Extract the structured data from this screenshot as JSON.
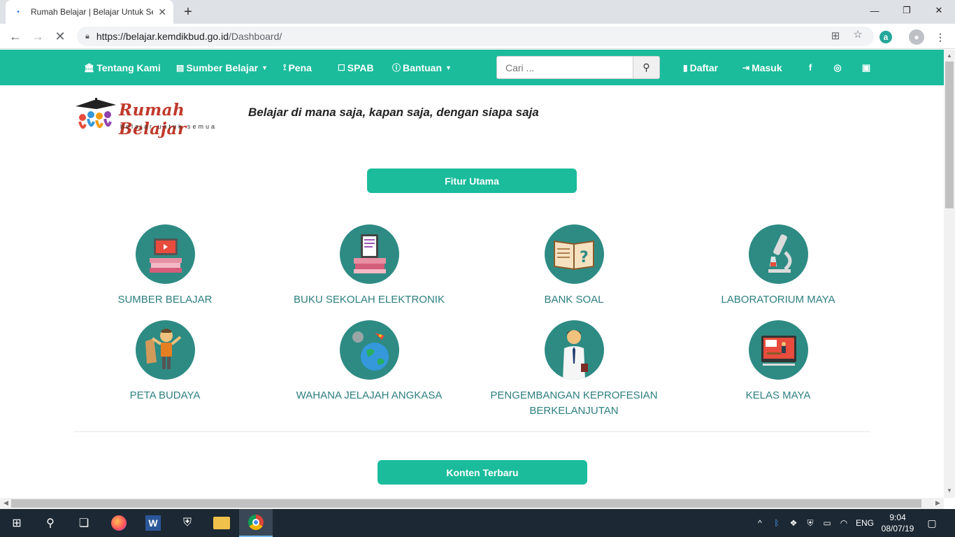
{
  "browser": {
    "tab_title": "Rumah Belajar | Belajar Untuk Semua",
    "new_tab": "+",
    "url_host": "https://belajar.kemdikbud.go.id",
    "url_path": "/Dashboard/",
    "minimize": "—",
    "restore": "❐",
    "close": "✕",
    "ext_label": "a"
  },
  "nav": {
    "tentang": "Tentang Kami",
    "sumber": "Sumber Belajar",
    "pena": "Pena",
    "spab": "SPAB",
    "bantuan": "Bantuan",
    "search_placeholder": "Cari ...",
    "daftar": "Daftar",
    "masuk": "Masuk",
    "facebook": "f"
  },
  "header": {
    "brand": "Rumah Belajar",
    "brand_sub": "belajar untuk semua",
    "tagline": "Belajar di mana saja, kapan saja, dengan siapa saja"
  },
  "sections": {
    "fitur_utama": "Fitur Utama",
    "konten_terbaru": "Konten Terbaru"
  },
  "features": [
    {
      "label": "SUMBER BELAJAR",
      "icon": "laptop-books-icon"
    },
    {
      "label": "BUKU SEKOLAH ELEKTRONIK",
      "icon": "ebook-icon"
    },
    {
      "label": "BANK SOAL",
      "icon": "question-book-icon"
    },
    {
      "label": "LABORATORIUM MAYA",
      "icon": "microscope-icon"
    },
    {
      "label": "PETA BUDAYA",
      "icon": "culture-map-icon"
    },
    {
      "label": "WAHANA JELAJAH ANGKASA",
      "icon": "globe-space-icon"
    },
    {
      "label": "PENGEMBANGAN KEPROFESIAN BERKELANJUTAN",
      "icon": "teacher-icon"
    },
    {
      "label": "KELAS MAYA",
      "icon": "virtual-class-icon"
    }
  ],
  "taskbar": {
    "lang": "ENG",
    "time": "9:04",
    "date": "08/07/19"
  }
}
